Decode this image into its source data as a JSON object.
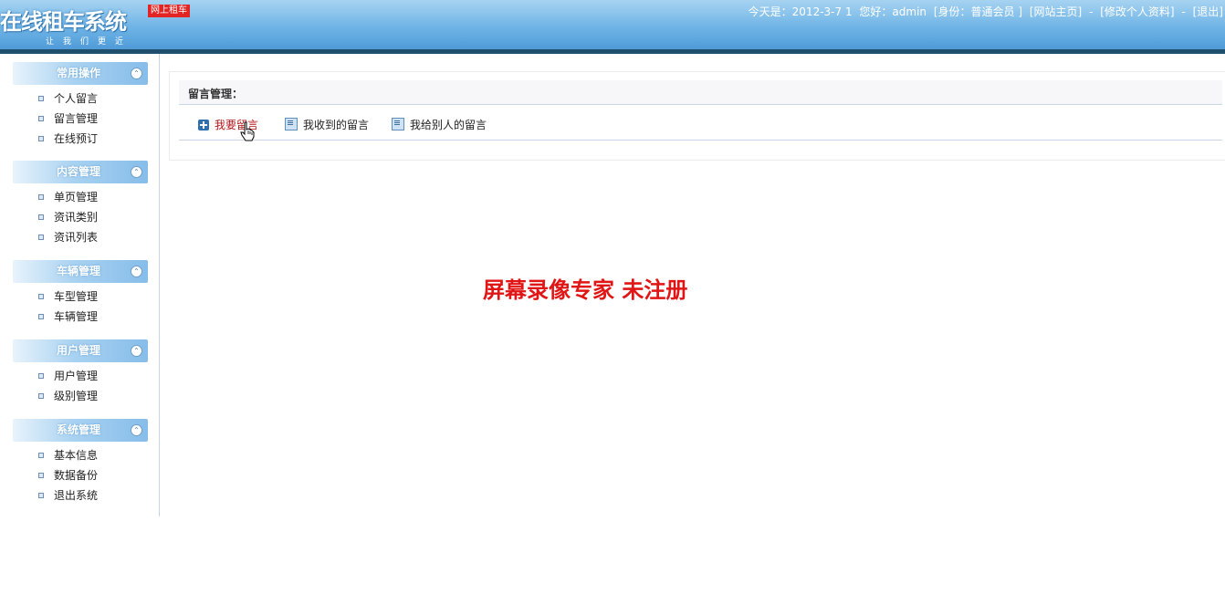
{
  "header": {
    "logo_title": "在线租车系统",
    "logo_slogan": "让我们更近",
    "logo_badge": "网上租车",
    "userbar": {
      "date": "今天是：2012-3-7 1",
      "greeting": "您好：admin",
      "identity": "[身份：普通会员 ]",
      "home_link": "[网站主页]",
      "sep1": "-",
      "profile_link": "[修改个人资料]",
      "sep2": "-",
      "logout_link": "[退出]"
    }
  },
  "sidebar": {
    "groups": [
      {
        "title": "常用操作",
        "items": [
          "个人留言",
          "留言管理",
          "在线预订"
        ]
      },
      {
        "title": "内容管理",
        "items": [
          "单页管理",
          "资讯类别",
          "资讯列表"
        ]
      },
      {
        "title": "车辆管理",
        "items": [
          "车型管理",
          "车辆管理"
        ]
      },
      {
        "title": "用户管理",
        "items": [
          "用户管理",
          "级别管理"
        ]
      },
      {
        "title": "系统管理",
        "items": [
          "基本信息",
          "数据备份",
          "退出系统"
        ]
      }
    ],
    "collapse_glyph": "⌃"
  },
  "main": {
    "panel_title": "留言管理：",
    "tabs": [
      {
        "label": "我要留言",
        "icon": "add-icon",
        "active": true
      },
      {
        "label": "我收到的留言",
        "icon": "list-icon",
        "active": false
      },
      {
        "label": "我给别人的留言",
        "icon": "list-icon",
        "active": false
      }
    ]
  },
  "watermark": "屏幕录像专家  未注册",
  "colors": {
    "header_dark": "#1f4f6c",
    "active_tab": "#b0161a",
    "watermark": "#e01616",
    "badge": "#e32424"
  }
}
